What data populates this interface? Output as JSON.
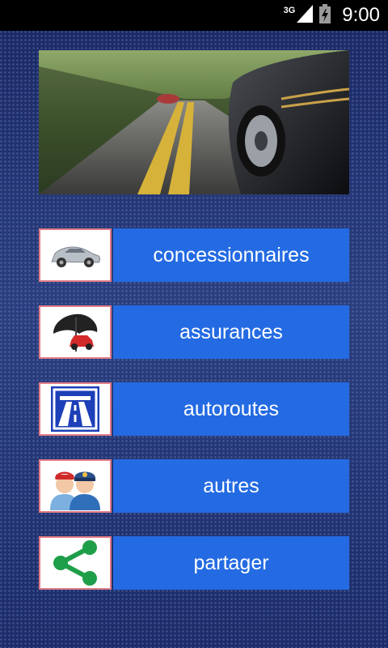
{
  "status_bar": {
    "network": "3G",
    "time": "9:00"
  },
  "hero": {
    "image": "car-on-road-photo"
  },
  "menu": [
    {
      "label": "concessionnaires",
      "icon": "car-icon"
    },
    {
      "label": "assurances",
      "icon": "umbrella-car-icon"
    },
    {
      "label": "autoroutes",
      "icon": "highway-sign-icon"
    },
    {
      "label": "autres",
      "icon": "people-icon"
    },
    {
      "label": "partager",
      "icon": "share-icon"
    }
  ],
  "colors": {
    "button_blue": "#246be3",
    "thumb_border": "#e27c86",
    "background": "#223572",
    "status_bar": "#000000",
    "share_green": "#1f9e4a"
  }
}
